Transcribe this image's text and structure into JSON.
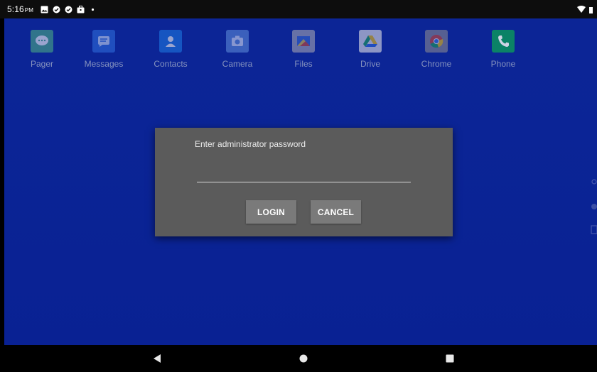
{
  "status_bar": {
    "time": "5:16",
    "ampm": "PM",
    "icons": [
      "gallery-icon",
      "check-circle-icon",
      "check-circle-icon",
      "briefcase-icon",
      "dot-icon"
    ],
    "right_icons": [
      "wifi-icon",
      "battery-icon"
    ]
  },
  "apps": [
    {
      "label": "Pager",
      "icon": "pager-icon",
      "color": "#4caf8c"
    },
    {
      "label": "Messages",
      "icon": "messages-icon",
      "color": "#2f6fe3"
    },
    {
      "label": "Contacts",
      "icon": "contacts-icon",
      "color": "#1f7ae8"
    },
    {
      "label": "Camera",
      "icon": "camera-icon",
      "color": "#5f8de0"
    },
    {
      "label": "Files",
      "icon": "files-icon",
      "color": "#8a8a9a"
    },
    {
      "label": "Drive",
      "icon": "drive-icon",
      "color": "#ffffff"
    },
    {
      "label": "Chrome",
      "icon": "chrome-icon",
      "color": "#7d7d7d"
    },
    {
      "label": "Phone",
      "icon": "phone-icon",
      "color": "#0c9a63"
    }
  ],
  "dialog": {
    "title": "Enter administrator password",
    "password_value": "",
    "login_label": "LOGIN",
    "cancel_label": "CANCEL"
  },
  "nav": [
    "back-icon",
    "home-icon",
    "recents-icon"
  ]
}
